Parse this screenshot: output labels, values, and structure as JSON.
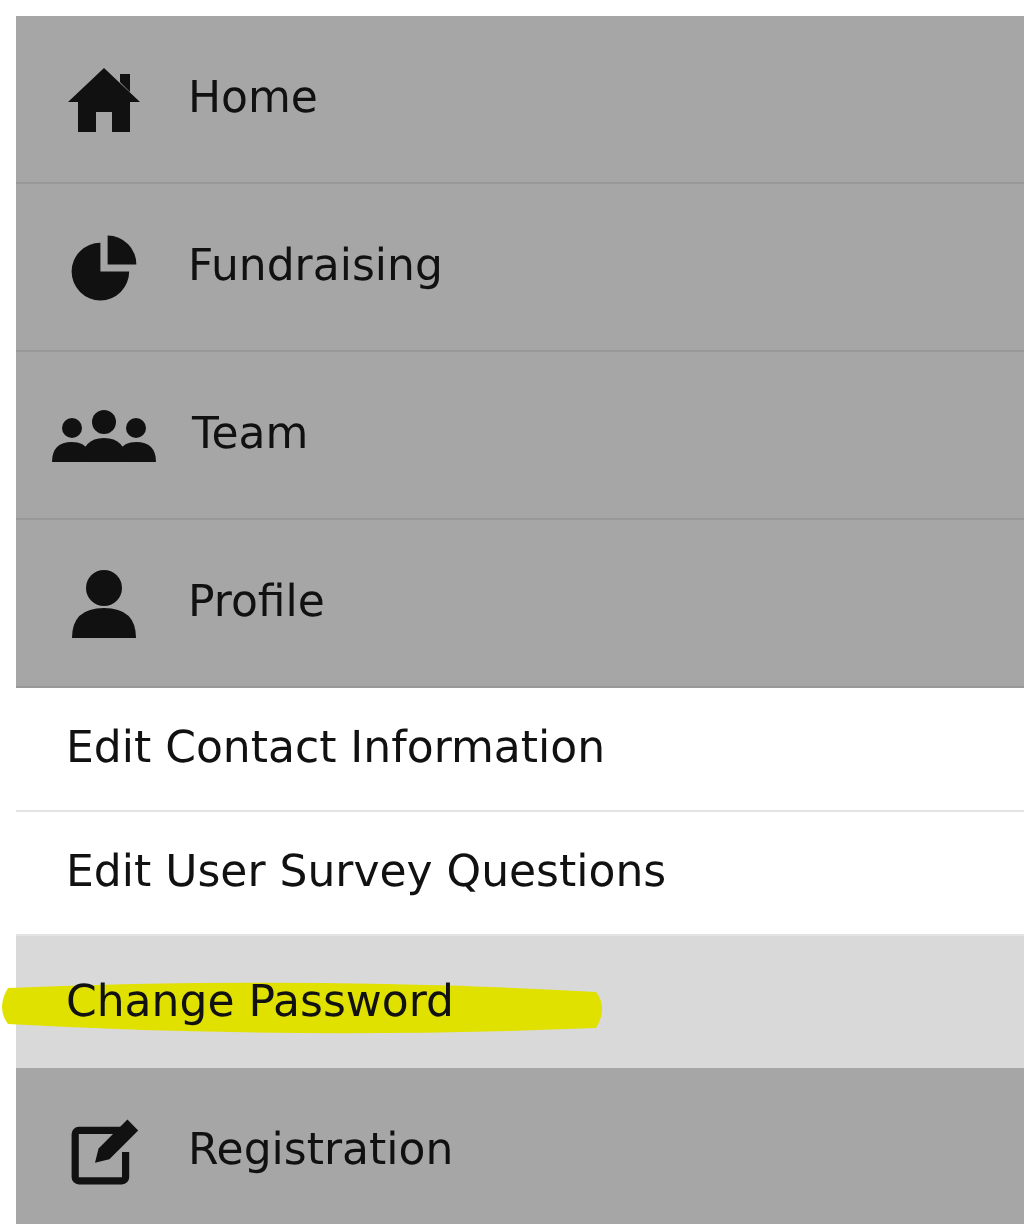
{
  "menu": [
    {
      "label": "Home"
    },
    {
      "label": "Fundraising"
    },
    {
      "label": "Team"
    },
    {
      "label": "Profile",
      "children": [
        {
          "label": "Edit Contact Information",
          "selected": false,
          "highlighted": false
        },
        {
          "label": "Edit User Survey Questions",
          "selected": false,
          "highlighted": false
        },
        {
          "label": "Change Password",
          "selected": true,
          "highlighted": true
        }
      ]
    },
    {
      "label": "Registration"
    }
  ]
}
